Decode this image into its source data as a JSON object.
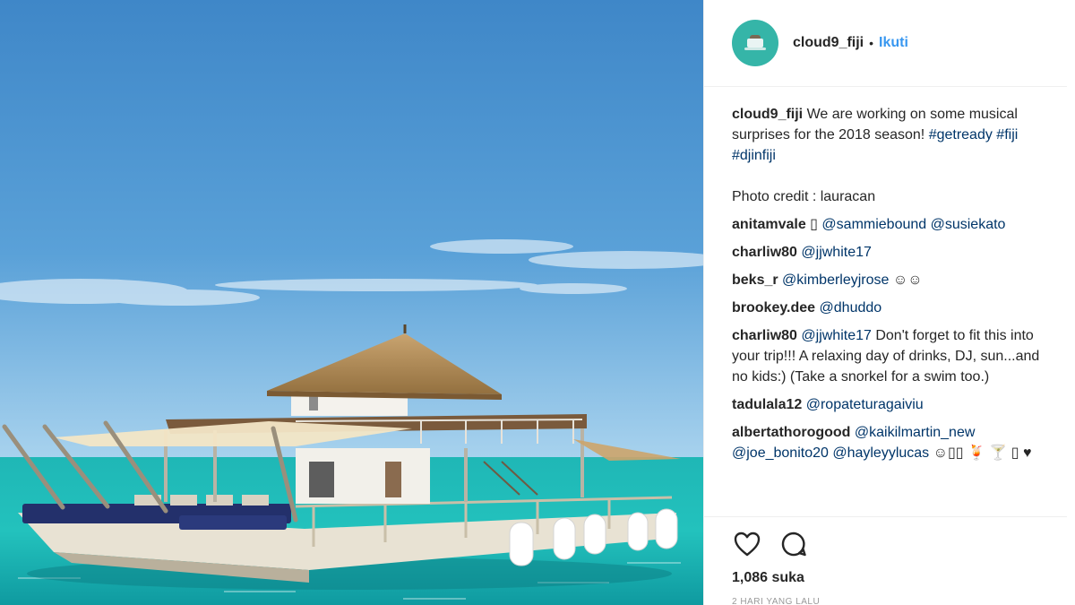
{
  "photo": {
    "alt_subject": "floating-bar-boat",
    "colors": {
      "sky_top": "#3f8ccd",
      "sky_bottom": "#a9d3ee",
      "sea": "#22b6b5",
      "thatch": "#b58e5d"
    }
  },
  "header": {
    "username": "cloud9_fiji",
    "separator": "•",
    "follow_label": "Ikuti"
  },
  "caption": {
    "username": "cloud9_fiji",
    "text": " We are working on some musical surprises for the 2018 season! ",
    "hashtags": "#getready #fiji #djinfiji",
    "credit": "Photo credit : lauracan"
  },
  "comments": [
    {
      "user": "anitamvale",
      "pre": " ▯ ",
      "mentions": "@sammiebound @susiekato",
      "text": ""
    },
    {
      "user": "charliw80",
      "pre": " ",
      "mentions": "@jjwhite17",
      "text": ""
    },
    {
      "user": "beks_r",
      "pre": " ",
      "mentions": "@kimberleyjrose",
      "text": " ☺☺"
    },
    {
      "user": "brookey.dee",
      "pre": " ",
      "mentions": "@dhuddo",
      "text": ""
    },
    {
      "user": "charliw80",
      "pre": " ",
      "mentions": "@jjwhite17",
      "text": " Don't forget to fit this into your trip!!! A relaxing day of drinks, DJ, sun...and no kids:) (Take a snorkel for a swim too.)"
    },
    {
      "user": "tadulala12",
      "pre": " ",
      "mentions": "@ropateturagaiviu",
      "text": ""
    },
    {
      "user": "albertathorogood",
      "pre": " ",
      "mentions": "@kaikilmartin_new @joe_bonito20 @hayleyylucas",
      "text": " ☺▯▯ 🍹 🍸 ▯ ♥"
    }
  ],
  "actions": {
    "like_icon": "heart-outline-icon",
    "comment_icon": "speech-bubble-icon",
    "likes_label": "1,086 suka",
    "time_label": "2 HARI YANG LALU"
  }
}
